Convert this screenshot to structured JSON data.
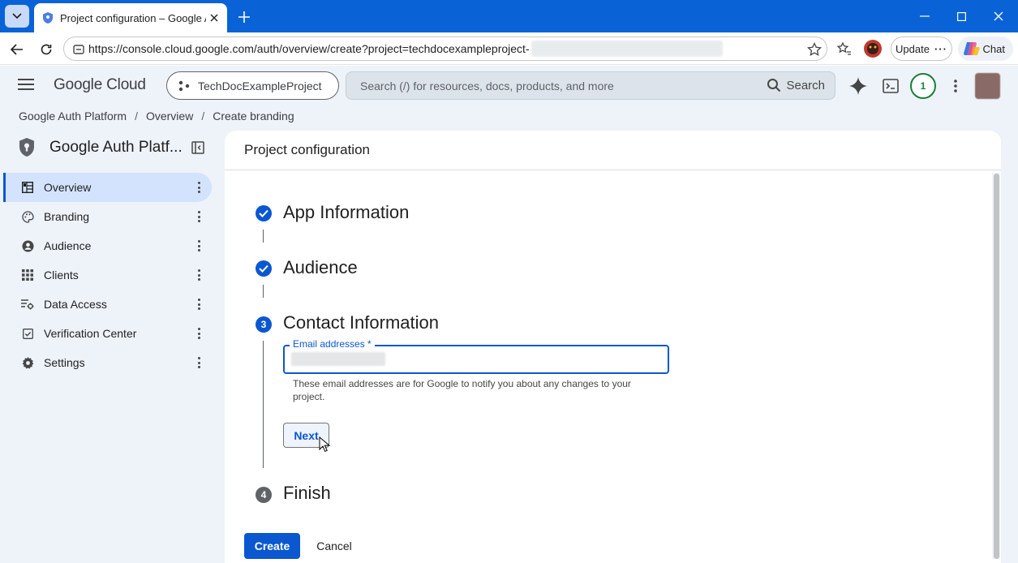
{
  "browser": {
    "tab_title": "Project configuration – Google Auth Platform",
    "url": "https://console.cloud.google.com/auth/overview/create?project=techdocexampleproject-",
    "update_label": "Update",
    "chat_label": "Chat",
    "accent": "#0a63d6"
  },
  "header": {
    "product": "Google Cloud",
    "project": "TechDocExampleProject",
    "search_placeholder": "Search (/) for resources, docs, products, and more",
    "search_button": "Search",
    "notification_count": "1"
  },
  "breadcrumb": [
    "Google Auth Platform",
    "Overview",
    "Create branding"
  ],
  "sidebar": {
    "title": "Google Auth Platf...",
    "items": [
      {
        "label": "Overview",
        "icon": "dashboard-icon",
        "active": true
      },
      {
        "label": "Branding",
        "icon": "palette-icon",
        "active": false
      },
      {
        "label": "Audience",
        "icon": "account-circle-icon",
        "active": false
      },
      {
        "label": "Clients",
        "icon": "grid-icon",
        "active": false
      },
      {
        "label": "Data Access",
        "icon": "data-access-icon",
        "active": false
      },
      {
        "label": "Verification Center",
        "icon": "checkbox-icon",
        "active": false
      },
      {
        "label": "Settings",
        "icon": "gear-icon",
        "active": false
      }
    ]
  },
  "main": {
    "title": "Project configuration",
    "steps": [
      {
        "number": "1",
        "title": "App Information",
        "state": "done"
      },
      {
        "number": "2",
        "title": "Audience",
        "state": "done"
      },
      {
        "number": "3",
        "title": "Contact Information",
        "state": "current"
      },
      {
        "number": "4",
        "title": "Finish",
        "state": "pending"
      }
    ],
    "email_label": "Email addresses *",
    "email_helper": "These email addresses are for Google to notify you about any changes to your project.",
    "next_label": "Next",
    "create_label": "Create",
    "cancel_label": "Cancel"
  }
}
